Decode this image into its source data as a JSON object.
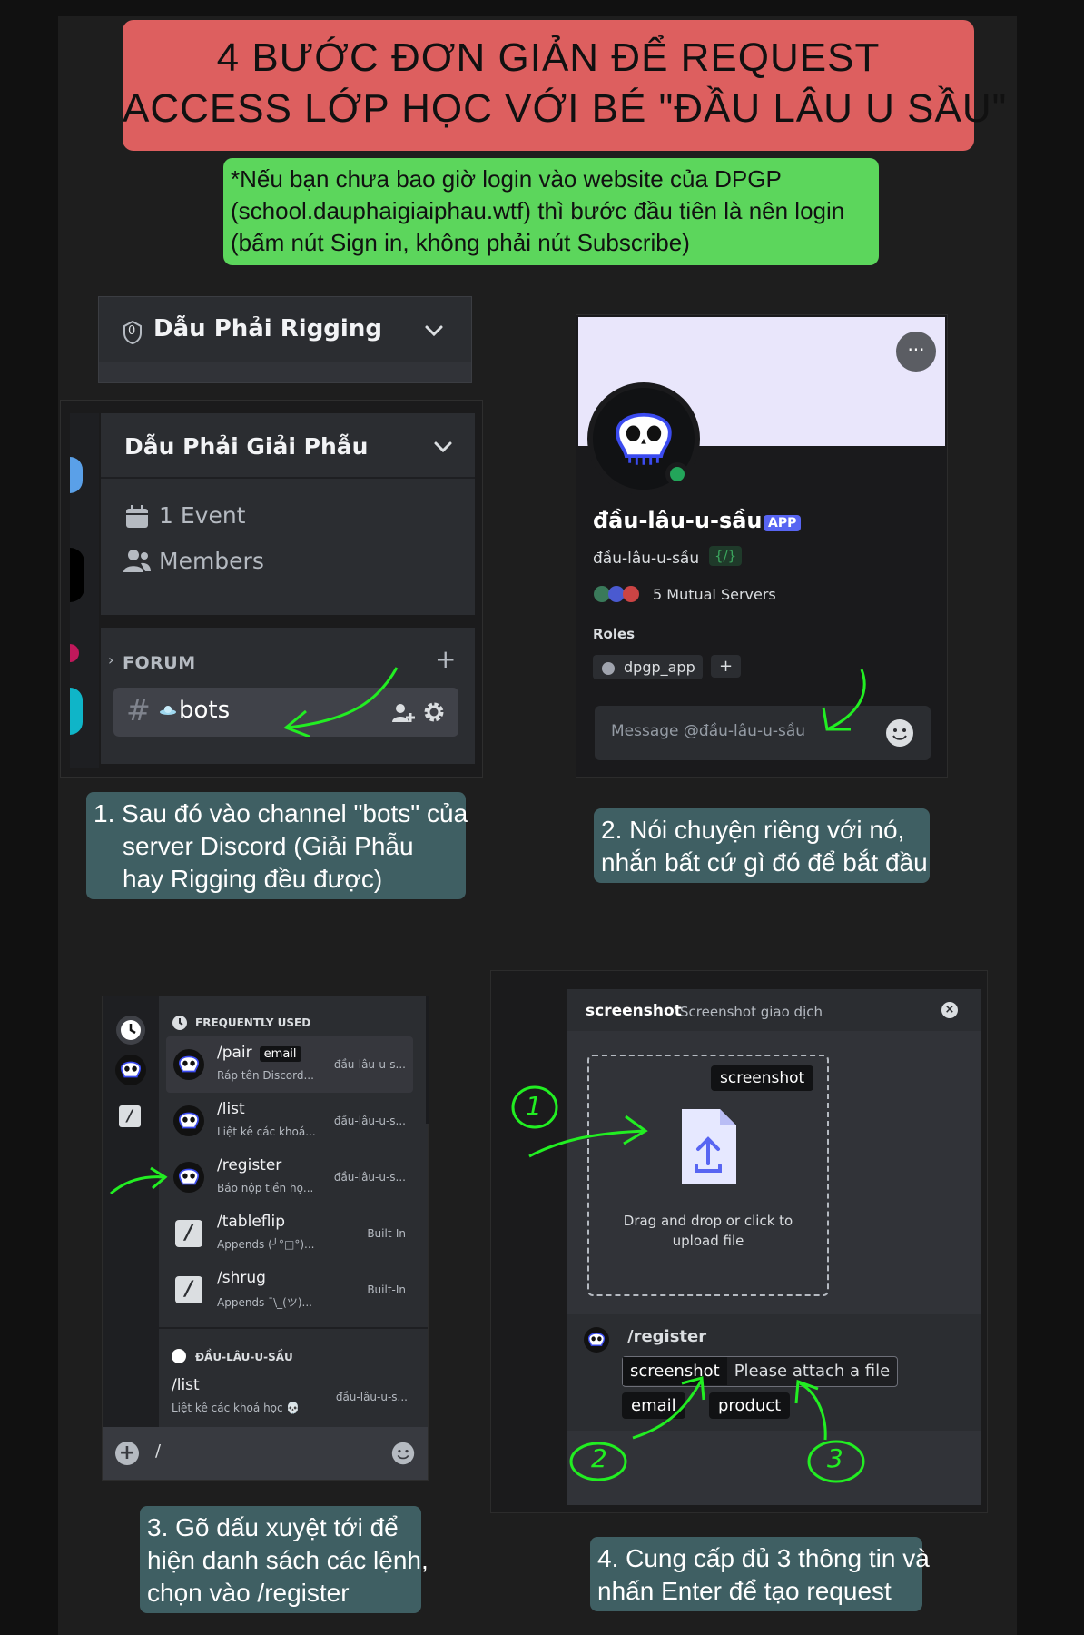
{
  "title": {
    "line1": "4 BƯỚC ĐƠN GIẢN ĐỂ REQUEST",
    "line2": "ACCESS LỚP HỌC VỚI BÉ \"ĐẦU LÂU U SẦU\""
  },
  "note": {
    "line1": "*Nếu bạn chưa bao giờ login vào website của DPGP",
    "line2": "(school.dauphaigiaiphau.wtf) thì bước đầu tiên là nên login",
    "line3": "(bấm nút Sign in, không phải nút Subscribe)"
  },
  "step1": {
    "server_rigging": "Dẫu Phải Rigging",
    "server_shield_count": "0",
    "server_giaiphau": "Dẫu Phải Giải Phẫu",
    "event": "1 Event",
    "members": "Members",
    "forum": "FORUM",
    "channel": "bots",
    "caption_line1": "1. Sau đó vào channel \"bots\" của",
    "caption_line2": "server Discord (Giải Phẫu",
    "caption_line3": "hay Rigging đều được)"
  },
  "step2": {
    "display_name": "đầu-lâu-u-sầu",
    "app_badge": "APP",
    "username": "đầu-lâu-u-sầu",
    "tag": "{/}",
    "mutual": "5 Mutual Servers",
    "roles_label": "Roles",
    "role": "dpgp_app",
    "add_role": "+",
    "message_placeholder": "Message @đầu-lâu-u-sầu",
    "more": "···",
    "caption_line1": "2. Nói chuyện riêng với nó,",
    "caption_line2": "nhắn bất cứ gì đó để bắt đầu"
  },
  "step3": {
    "freq_header": "FREQUENTLY USED",
    "commands": [
      {
        "name": "/pair",
        "tag": "email",
        "desc": "Ráp tên Discord...",
        "source": "đầu-lâu-u-s..."
      },
      {
        "name": "/list",
        "tag": "",
        "desc": "Liệt kê các khoá...",
        "source": "đầu-lâu-u-s..."
      },
      {
        "name": "/register",
        "tag": "",
        "desc": "Báo nộp tiền họ...",
        "source": "đầu-lâu-u-s..."
      },
      {
        "name": "/tableflip",
        "tag": "",
        "desc": "Appends (╯°□°)...",
        "source": "Built-In"
      },
      {
        "name": "/shrug",
        "tag": "",
        "desc": "Appends ¯\\_(ツ)...",
        "source": "Built-In"
      }
    ],
    "bot_header": "ĐẦU-LÂU-U-SẦU",
    "bot_cmd": {
      "name": "/list",
      "desc": "Liệt kê các khoá học 💀",
      "source": "đầu-lâu-u-s..."
    },
    "input_value": "/",
    "caption_line1": "3. Gõ dấu xuyệt tới để",
    "caption_line2": "hiện danh sách các lệnh,",
    "caption_line3": "chọn vào /register"
  },
  "step4": {
    "header_name": "screenshot",
    "header_desc": "Screenshot giao dịch",
    "chip": "screenshot",
    "drop_line1": "Drag and drop or click to",
    "drop_line2": "upload file",
    "command": "/register",
    "opt_key": "screenshot",
    "opt_val": "Please attach a file",
    "email": "email",
    "product": "product",
    "num1": "1",
    "num2": "2",
    "num3": "3",
    "caption_line1": "4. Cung cấp đủ 3 thông tin và",
    "caption_line2": "nhấn Enter để tạo request"
  },
  "colors": {
    "title_bg": "#dd5f5f",
    "note_bg": "#5cd65c",
    "caption_bg": "#3f5f63",
    "arrow_green": "#22ee22"
  }
}
